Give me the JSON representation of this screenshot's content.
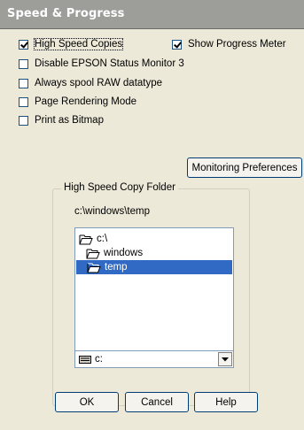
{
  "title": "Speed & Progress",
  "options": {
    "high_speed_copies": {
      "label": "High Speed Copies",
      "checked": true
    },
    "show_progress_meter": {
      "label": "Show Progress Meter",
      "checked": true
    },
    "disable_status_monitor": {
      "label": "Disable EPSON Status Monitor 3",
      "checked": false
    },
    "always_spool_raw": {
      "label": "Always spool RAW datatype",
      "checked": false
    },
    "page_rendering_mode": {
      "label": "Page Rendering Mode",
      "checked": false
    },
    "print_as_bitmap": {
      "label": "Print as Bitmap",
      "checked": false
    }
  },
  "monitoring_button": "Monitoring Preferences",
  "copy_folder": {
    "legend": "High Speed Copy Folder",
    "current_path": "c:\\windows\\temp",
    "tree": [
      {
        "label": "c:\\",
        "selected": false
      },
      {
        "label": "windows",
        "selected": false
      },
      {
        "label": "temp",
        "selected": true
      }
    ],
    "drive": "c:"
  },
  "buttons": {
    "ok": "OK",
    "cancel": "Cancel",
    "help": "Help"
  }
}
